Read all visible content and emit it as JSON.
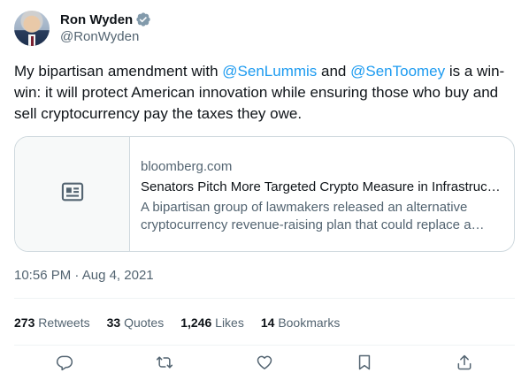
{
  "author": {
    "display_name": "Ron Wyden",
    "handle": "@RonWyden",
    "verified_icon": "verified-badge-icon"
  },
  "tweet": {
    "text_part1": "My bipartisan amendment with ",
    "mention1": "@SenLummis",
    "text_part2": " and ",
    "mention2": "@SenToomey",
    "text_part3": " is a win-win: it will protect American innovation while ensuring those who buy and sell cryptocurrency pay the taxes they owe."
  },
  "card": {
    "domain": "bloomberg.com",
    "title": "Senators Pitch More Targeted Crypto Measure in Infrastructure Bill",
    "description": "A bipartisan group of lawmakers released an alternative cryptocurrency revenue-raising plan that could replace a provision in the infrastructure bill.",
    "thumb_icon": "article-icon"
  },
  "timestamp": {
    "time": "10:56 PM",
    "separator": " · ",
    "date": "Aug 4, 2021"
  },
  "stats": {
    "retweets_count": "273",
    "retweets_label": "Retweets",
    "quotes_count": "33",
    "quotes_label": "Quotes",
    "likes_count": "1,246",
    "likes_label": "Likes",
    "bookmarks_count": "14",
    "bookmarks_label": "Bookmarks"
  },
  "actions": [
    "reply-icon",
    "retweet-icon",
    "like-icon",
    "bookmark-icon",
    "share-icon"
  ],
  "colors": {
    "accent": "#1d9bf0",
    "text": "#0f1419",
    "secondary": "#536471",
    "border": "#cfd9de"
  }
}
